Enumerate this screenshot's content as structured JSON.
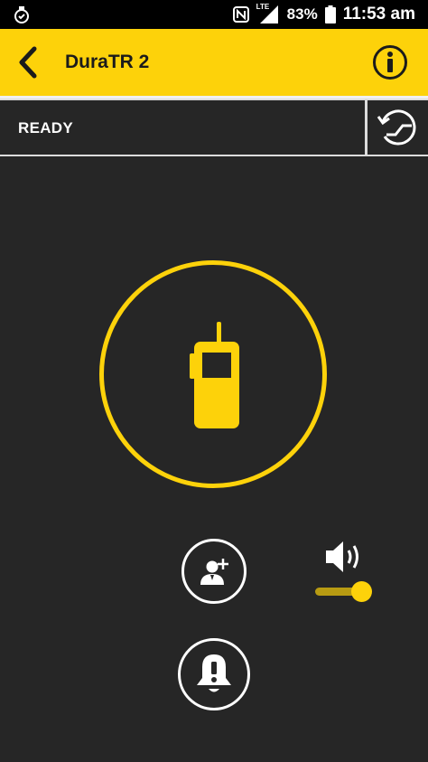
{
  "statusbar": {
    "battery_percent": "83%",
    "time": "11:53 am",
    "network": "LTE"
  },
  "appbar": {
    "title": "DuraTR 2"
  },
  "status": {
    "text": "READY"
  },
  "volume": {
    "level": 0.85
  },
  "colors": {
    "accent": "#fdd20a",
    "background": "#262626",
    "appbar_text": "#1b1b1b"
  },
  "icons": {
    "back": "chevron-left-icon",
    "info": "info-icon",
    "scan": "scan-icon",
    "radio": "walkie-talkie-icon",
    "add_contact": "add-contact-icon",
    "alert": "alert-bell-icon",
    "volume": "speaker-icon"
  }
}
